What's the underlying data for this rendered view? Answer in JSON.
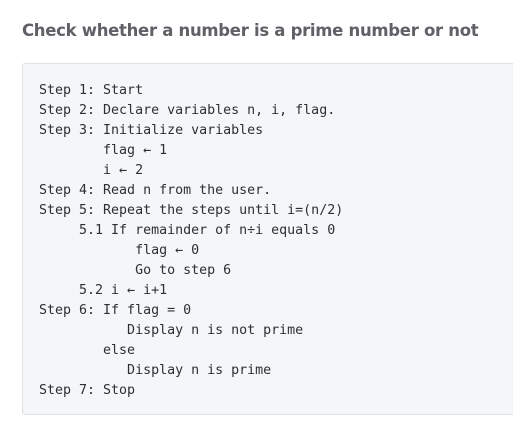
{
  "title": "Check whether a number is a prime number or not",
  "code_lines": [
    "Step 1: Start",
    "Step 2: Declare variables n, i, flag.",
    "Step 3: Initialize variables",
    "        flag ← 1",
    "        i ← 2",
    "Step 4: Read n from the user.",
    "Step 5: Repeat the steps until i=(n/2)",
    "     5.1 If remainder of n÷i equals 0",
    "            flag ← 0",
    "            Go to step 6",
    "     5.2 i ← i+1",
    "Step 6: If flag = 0",
    "           Display n is not prime",
    "        else",
    "           Display n is prime",
    "Step 7: Stop"
  ]
}
